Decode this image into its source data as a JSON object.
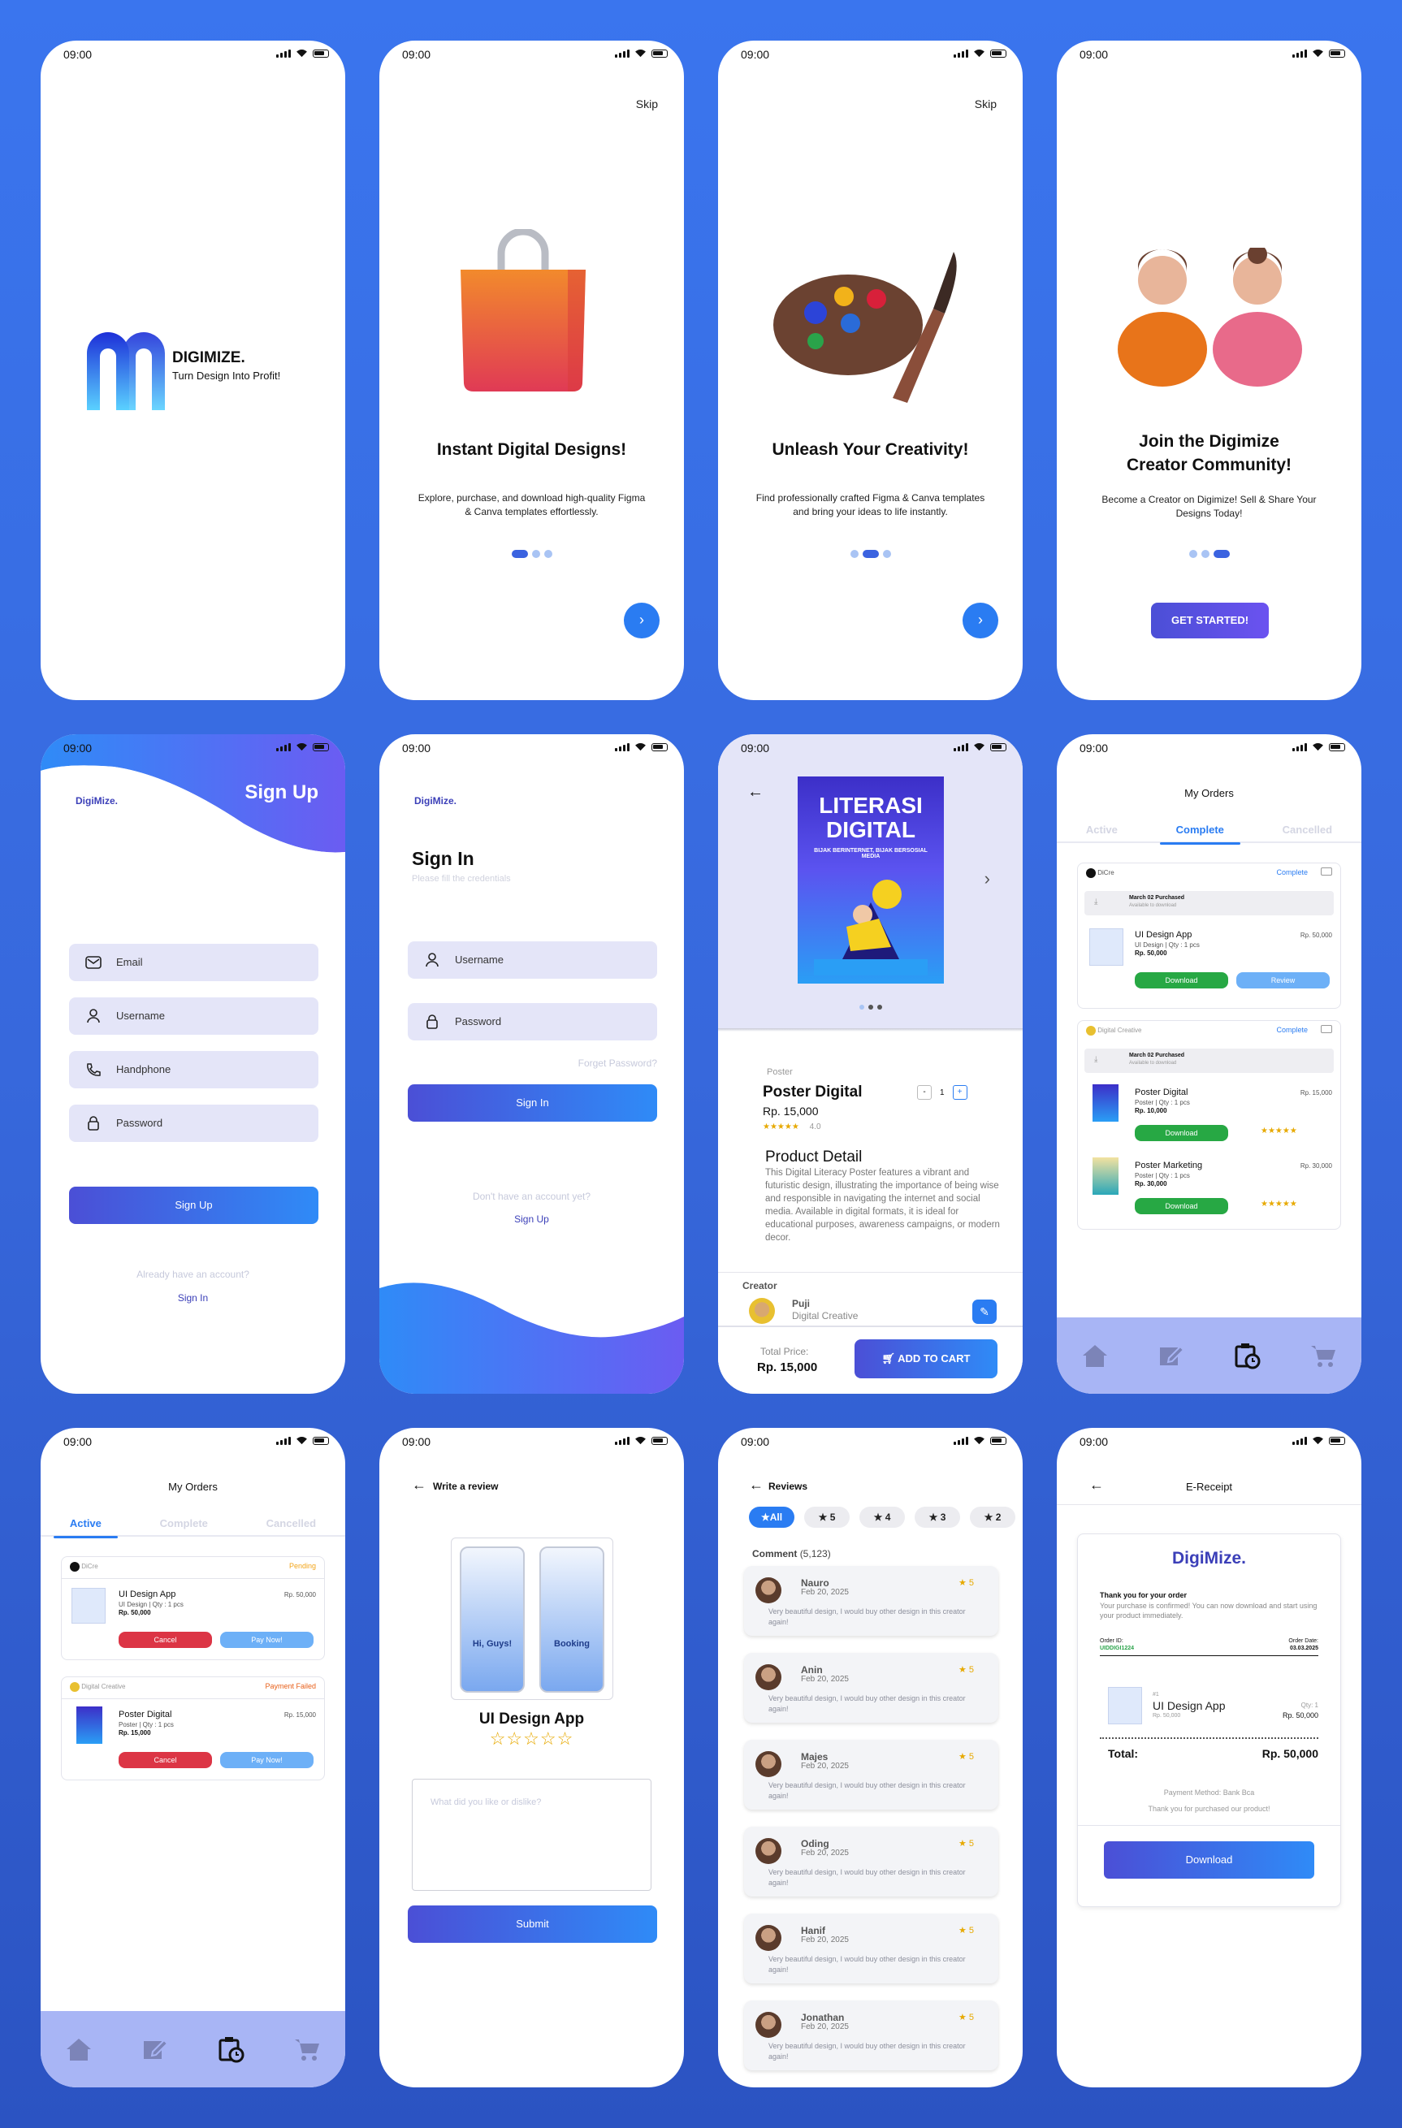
{
  "status": {
    "time": "09:00"
  },
  "splash": {
    "brand": "DIGIMIZE.",
    "tagline": "Turn Design Into Profit!"
  },
  "onboarding": [
    {
      "skip": "Skip",
      "title": "Instant Digital Designs!",
      "desc": "Explore, purchase, and download high-quality Figma & Canva templates effortlessly.",
      "next": "›"
    },
    {
      "skip": "Skip",
      "title": "Unleash Your Creativity!",
      "desc": "Find professionally crafted Figma & Canva templates and bring your ideas to life instantly.",
      "next": "›"
    },
    {
      "title1": "Join the Digimize",
      "title2": "Creator Community!",
      "desc": "Become a Creator on Digimize! Sell & Share Your Designs Today!",
      "cta": "GET STARTED!"
    }
  ],
  "signup": {
    "logo": "DigiMize.",
    "heading": "Sign Up",
    "email": "Email",
    "username": "Username",
    "phone": "Handphone",
    "password": "Password",
    "button": "Sign Up",
    "have_account": "Already have an account?",
    "signin_link": "Sign In"
  },
  "signin": {
    "logo": "DigiMize.",
    "heading": "Sign In",
    "sub": "Please fill the credentials",
    "username": "Username",
    "password": "Password",
    "forgot": "Forget Password?",
    "button": "Sign In",
    "no_account": "Don't have an account yet?",
    "signup_link": "Sign Up"
  },
  "product": {
    "poster_title1": "LITERASI",
    "poster_title2": "DIGITAL",
    "poster_sub": "BIJAK BERINTERNET, BIJAK BERSOSIAL MEDIA",
    "category": "Poster",
    "name": "Poster Digital",
    "price": "Rp. 15,000",
    "rating": "4.0",
    "qty": "1",
    "minus": "-",
    "plus": "+",
    "detail_title": "Product Detail",
    "detail": "This Digital Literacy Poster features a vibrant and futuristic design, illustrating the importance of being wise and responsible in navigating the internet and social media. Available in digital formats, it is ideal for educational purposes, awareness campaigns, or modern decor.",
    "creator_label": "Creator",
    "creator_name": "Puji",
    "creator_role": "Digital Creative",
    "total_label": "Total Price:",
    "total": "Rp. 15,000",
    "cart": "ADD TO CART"
  },
  "orders_complete": {
    "title": "My Orders",
    "tabs": [
      "Active",
      "Complete",
      "Cancelled"
    ],
    "card1": {
      "seller": "DiCre",
      "status": "Complete",
      "month": "March 02 Purchased",
      "note": "Available to download",
      "item": "UI Design App",
      "meta": "UI Design  |  Qty : 1 pcs",
      "item_price": "Rp. 50,000",
      "total": "Rp. 50,000",
      "download": "Download",
      "review": "Review"
    },
    "card2": {
      "seller": "Digital Creative",
      "status": "Complete",
      "month": "March 02 Purchased",
      "note": "Available to download",
      "items": [
        {
          "name": "Poster Digital",
          "meta": "Poster  |  Qty : 1 pcs",
          "price": "Rp. 15,000",
          "total": "Rp. 10,000",
          "download": "Download",
          "stars": "★★★★★"
        },
        {
          "name": "Poster Marketing",
          "meta": "Poster  |  Qty : 1 pcs",
          "price": "Rp. 30,000",
          "total": "Rp. 30,000",
          "download": "Download",
          "stars": "★★★★★"
        }
      ]
    }
  },
  "orders_active": {
    "title": "My Orders",
    "tabs": [
      "Active",
      "Complete",
      "Cancelled"
    ],
    "card1": {
      "seller": "DiCre",
      "status": "Pending",
      "item": "UI Design App",
      "meta": "UI Design  |  Qty : 1 pcs",
      "price": "Rp. 50,000",
      "total": "Rp. 50,000",
      "cancel": "Cancel",
      "pay": "Pay Now!"
    },
    "card2": {
      "seller": "Digital Creative",
      "status": "Payment Failed",
      "item": "Poster Digital",
      "meta": "Poster  |  Qty : 1 pcs",
      "price": "Rp. 15,000",
      "total": "Rp. 15,000",
      "cancel": "Cancel",
      "pay": "Pay Now!"
    }
  },
  "review": {
    "header": "Write a review",
    "mock1_title": "Hi, Guys!",
    "mock2_title": "Booking",
    "product": "UI Design App",
    "stars": "☆☆☆☆☆",
    "placeholder": "What did you like or dislike?",
    "submit": "Submit"
  },
  "reviews": {
    "header": "Reviews",
    "filters": [
      "★All",
      "★ 5",
      "★ 4",
      "★ 3",
      "★ 2"
    ],
    "comment_label": "Comment",
    "comment_count": "(5,123)",
    "items": [
      {
        "name": "Nauro",
        "date": "Feb 20,  2025",
        "stars": "★ 5",
        "text": "Very beautiful design, I would buy other design in this creator again!"
      },
      {
        "name": "Anin",
        "date": "Feb 20,  2025",
        "stars": "★ 5",
        "text": "Very beautiful design, I would buy other design in this creator again!"
      },
      {
        "name": "Majes",
        "date": "Feb 20,  2025",
        "stars": "★ 5",
        "text": "Very beautiful design, I would buy other design in this creator again!"
      },
      {
        "name": "Oding",
        "date": "Feb 20,  2025",
        "stars": "★ 5",
        "text": "Very beautiful design, I would buy other design in this creator again!"
      },
      {
        "name": "Hanif",
        "date": "Feb 20,  2025",
        "stars": "★ 5",
        "text": "Very beautiful design, I would buy other design in this creator again!"
      },
      {
        "name": "Jonathan",
        "date": "Feb 20,  2025",
        "stars": "★ 5",
        "text": "Very beautiful design, I would buy other design in this creator again!"
      }
    ]
  },
  "receipt": {
    "header": "E-Receipt",
    "logo": "DigiMize.",
    "thanks": "Thank you for your order",
    "msg": "Your purchase is confirmed! You can now download and start using your product immediately.",
    "order_id_label": "Order ID:",
    "order_id": "UIDDIGI1224",
    "order_date_label": "Order Date:",
    "order_date": "03.03.2025",
    "item_no": "#1",
    "item": "UI Design App",
    "item_sub": "Rp. 50,000",
    "qty": "Qty: 1",
    "item_price": "Rp. 50,000",
    "total_label": "Total:",
    "total": "Rp. 50,000",
    "method": "Payment Method: Bank Bca",
    "thanks2": "Thank you for purchased our product!",
    "download": "Download"
  }
}
